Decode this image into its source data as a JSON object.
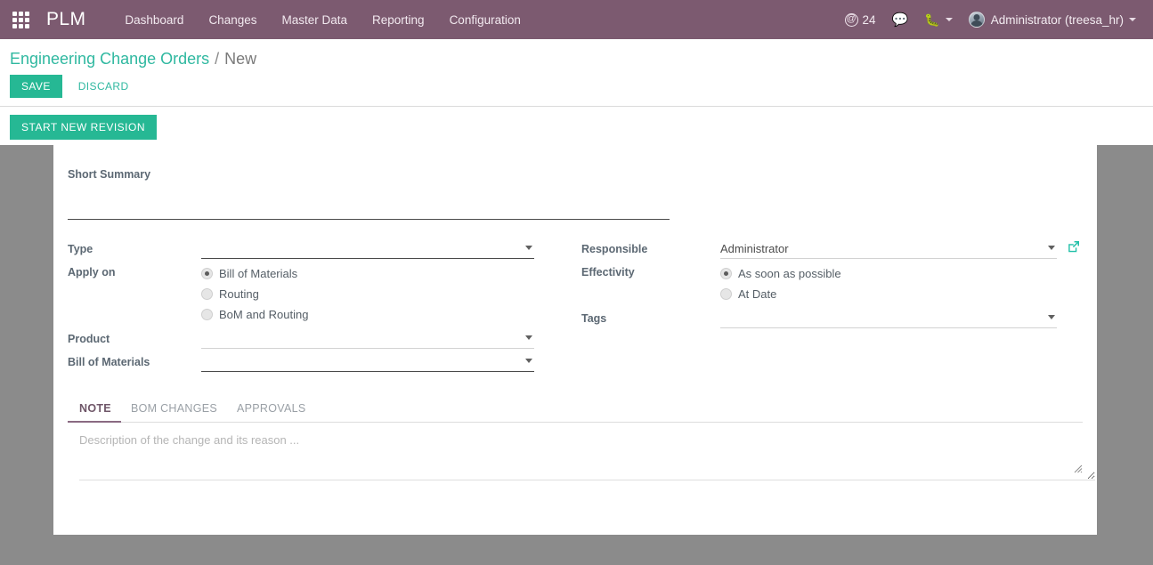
{
  "navbar": {
    "apps_icon": "apps-grid-icon",
    "brand": "PLM",
    "menu": [
      {
        "label": "Dashboard"
      },
      {
        "label": "Changes"
      },
      {
        "label": "Master Data"
      },
      {
        "label": "Reporting"
      },
      {
        "label": "Configuration"
      }
    ],
    "mentions": {
      "icon": "at-icon",
      "count": "24"
    },
    "messages_icon": "chat-bubble-icon",
    "debug_icon": "bug-icon",
    "user": "Administrator (treesa_hr)",
    "avatar": "user-avatar"
  },
  "control_panel": {
    "breadcrumb": {
      "root": "Engineering Change Orders",
      "separator": "/",
      "current": "New"
    },
    "save_label": "SAVE",
    "discard_label": "DISCARD",
    "start_new_revision_label": "START NEW REVISION"
  },
  "form": {
    "summary": {
      "label": "Short Summary",
      "value": "",
      "placeholder": ""
    },
    "left": {
      "type": {
        "label": "Type",
        "value": "",
        "placeholder": ""
      },
      "apply_on": {
        "label": "Apply on",
        "options": [
          {
            "label": "Bill of Materials",
            "selected": true
          },
          {
            "label": "Routing",
            "selected": false
          },
          {
            "label": "BoM and Routing",
            "selected": false
          }
        ]
      },
      "product": {
        "label": "Product",
        "value": "",
        "placeholder": ""
      },
      "bom": {
        "label": "Bill of Materials",
        "value": "",
        "placeholder": ""
      }
    },
    "right": {
      "responsible": {
        "label": "Responsible",
        "value": "Administrator",
        "placeholder": ""
      },
      "effectivity": {
        "label": "Effectivity",
        "options": [
          {
            "label": "As soon as possible",
            "selected": true
          },
          {
            "label": "At Date",
            "selected": false
          }
        ]
      },
      "tags": {
        "label": "Tags",
        "value": "",
        "placeholder": ""
      }
    }
  },
  "notebook": {
    "tabs": [
      {
        "label": "NOTE",
        "active": true
      },
      {
        "label": "BOM CHANGES",
        "active": false
      },
      {
        "label": "APPROVALS",
        "active": false
      }
    ],
    "note": {
      "value": "",
      "placeholder": "Description of the change and its reason ..."
    }
  },
  "colors": {
    "navbar_bg": "#7c5a70",
    "accent_teal": "#26b894",
    "sheet_bg": "#8b8b8b",
    "tab_active": "#6f5668",
    "label_text": "#5c6873"
  }
}
